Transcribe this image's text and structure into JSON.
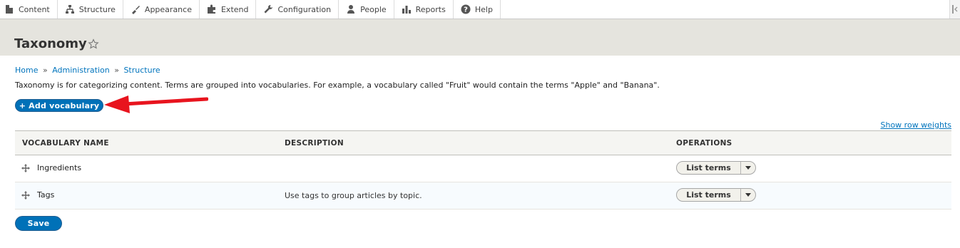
{
  "toolbar": {
    "items": [
      {
        "label": "Content",
        "icon": "content-icon"
      },
      {
        "label": "Structure",
        "icon": "structure-icon"
      },
      {
        "label": "Appearance",
        "icon": "appearance-icon"
      },
      {
        "label": "Extend",
        "icon": "extend-icon"
      },
      {
        "label": "Configuration",
        "icon": "configuration-icon"
      },
      {
        "label": "People",
        "icon": "people-icon"
      },
      {
        "label": "Reports",
        "icon": "reports-icon"
      },
      {
        "label": "Help",
        "icon": "help-icon"
      }
    ]
  },
  "page": {
    "title": "Taxonomy",
    "breadcrumb": [
      "Home",
      "Administration",
      "Structure"
    ],
    "breadcrumb_separator": "»",
    "intro": "Taxonomy is for categorizing content. Terms are grouped into vocabularies. For example, a vocabulary called \"Fruit\" would contain the terms \"Apple\" and \"Banana\".",
    "add_button": "+ Add vocabulary",
    "row_weights_link": "Show row weights",
    "save_button": "Save"
  },
  "table": {
    "headers": [
      "Vocabulary name",
      "Description",
      "Operations"
    ],
    "rows": [
      {
        "name": "Ingredients",
        "description": "",
        "operation": "List terms"
      },
      {
        "name": "Tags",
        "description": "Use tags to group articles by topic.",
        "operation": "List terms"
      }
    ]
  },
  "colors": {
    "accent": "#0071b8",
    "link": "#0074bd",
    "header_bg": "#e5e4de",
    "annotation_arrow": "#e8141e"
  }
}
